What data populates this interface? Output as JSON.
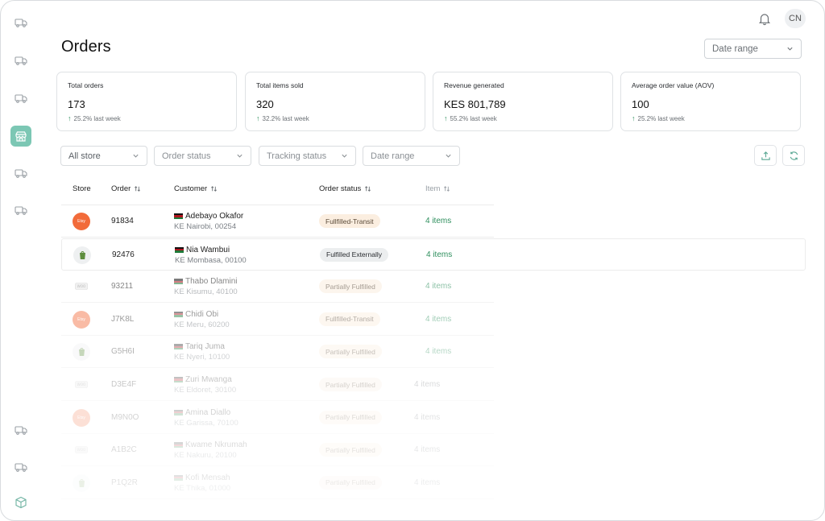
{
  "header": {
    "title": "Orders",
    "avatar_initials": "CN",
    "date_range_label": "Date range"
  },
  "sidebar": {
    "items": [
      {
        "icon": "truck-icon",
        "name": "nav-shipments-1"
      },
      {
        "icon": "truck-icon",
        "name": "nav-shipments-2"
      },
      {
        "icon": "truck-icon",
        "name": "nav-shipments-3"
      },
      {
        "icon": "store-icon",
        "name": "nav-orders",
        "active": true
      },
      {
        "icon": "truck-icon",
        "name": "nav-shipments-4"
      },
      {
        "icon": "truck-icon",
        "name": "nav-shipments-5"
      },
      {
        "icon": "truck-icon",
        "name": "nav-shipments-6"
      },
      {
        "icon": "truck-icon",
        "name": "nav-shipments-7"
      },
      {
        "icon": "box-icon",
        "name": "nav-logo"
      }
    ]
  },
  "stats": [
    {
      "label": "Total orders",
      "value": "173",
      "change": "25.2% last week"
    },
    {
      "label": "Total items sold",
      "value": "320",
      "change": "32.2% last week"
    },
    {
      "label": "Revenue generated",
      "value": "KES 801,789",
      "change": "55.2% last week"
    },
    {
      "label": "Average order value (AOV)",
      "value": "100",
      "change": "25.2% last week"
    }
  ],
  "filters": {
    "store": "All store",
    "order_status": "Order status",
    "tracking_status": "Tracking status",
    "date_range": "Date range"
  },
  "table": {
    "headers": {
      "store": "Store",
      "order": "Order",
      "customer": "Customer",
      "order_status": "Order status",
      "item": "Item"
    },
    "rows": [
      {
        "store": "etsy",
        "order": "91834",
        "name": "Adebayo Okafor",
        "location": "KE Nairobi, 00254",
        "status": "Fullfilled-Transit",
        "items": "4 items"
      },
      {
        "store": "shopify",
        "order": "92476",
        "name": "Nia Wambui",
        "location": "KE Mombasa, 00100",
        "status": "Fulfilled Externally",
        "items": "4 items"
      },
      {
        "store": "woo",
        "order": "93211",
        "name": "Thabo Dlamini",
        "location": "KE Kisumu, 40100",
        "status": "Partially Fulfilled",
        "items": "4 items"
      },
      {
        "store": "etsy",
        "order": "J7K8L",
        "name": "Chidi Obi",
        "location": "KE Meru, 60200",
        "status": "Fullfilled-Transit",
        "items": "4 items"
      },
      {
        "store": "shopify",
        "order": "G5H6I",
        "name": "Tariq Juma",
        "location": "KE Nyeri, 10100",
        "status": "Partially Fulfilled",
        "items": "4 items"
      },
      {
        "store": "woo",
        "order": "D3E4F",
        "name": "Zuri Mwanga",
        "location": "KE Eldoret, 30100",
        "status": "Partially Fulfilled",
        "items": "4 items"
      },
      {
        "store": "etsy",
        "order": "M9N0O",
        "name": "Amina Diallo",
        "location": "KE Garissa, 70100",
        "status": "Partially Fulfilled",
        "items": "4 items"
      },
      {
        "store": "woo",
        "order": "A1B2C",
        "name": "Kwame Nkrumah",
        "location": "KE Nakuru, 20100",
        "status": "Partially Fulfilled",
        "items": "4 items"
      },
      {
        "store": "shopify",
        "order": "P1Q2R",
        "name": "Kofi Mensah",
        "location": "KE Thika, 01000",
        "status": "Partially Fulfilled",
        "items": "4 items"
      }
    ]
  },
  "colors": {
    "accent": "#7cc7b4",
    "positive": "#2f8f5e",
    "etsy": "#f26b3a",
    "shopify": "#5e8e3e"
  }
}
